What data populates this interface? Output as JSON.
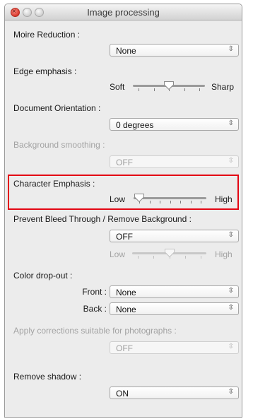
{
  "window": {
    "title": "Image processing"
  },
  "moire": {
    "label": "Moire Reduction :",
    "value": "None"
  },
  "edge": {
    "label": "Edge emphasis :",
    "min_label": "Soft",
    "max_label": "Sharp",
    "level": 0.5,
    "ticks": 5
  },
  "orientation": {
    "label": "Document Orientation :",
    "value": "0 degrees"
  },
  "smoothing": {
    "label": "Background smoothing :",
    "value": "OFF",
    "enabled": false
  },
  "character": {
    "label": "Character Emphasis :",
    "min_label": "Low",
    "max_label": "High",
    "level": 0.0,
    "ticks": 7,
    "highlighted": true,
    "highlight_color": "#e30613"
  },
  "bleed": {
    "label": "Prevent Bleed Through / Remove Background :",
    "value": "OFF",
    "min_label": "Low",
    "max_label": "High",
    "level": 0.5,
    "ticks": 5,
    "slider_enabled": false
  },
  "color_dropout": {
    "label": "Color drop-out :",
    "front": {
      "label": "Front :",
      "value": "None"
    },
    "back": {
      "label": "Back :",
      "value": "None"
    }
  },
  "photo": {
    "label": "Apply corrections suitable for photographs :",
    "value": "OFF",
    "enabled": false
  },
  "shadow": {
    "label": "Remove shadow :",
    "value": "ON"
  },
  "icons": {
    "select_arrow": "up-down-chevron",
    "thumb": "downward-triangle-thumb"
  }
}
